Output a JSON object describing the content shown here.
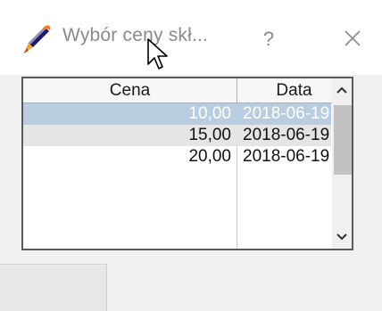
{
  "window": {
    "title": "Wybór ceny skł...",
    "help_glyph": "?",
    "close_glyph": "×"
  },
  "icons": {
    "app": "pencil-flame-icon",
    "help": "question-icon",
    "close": "close-icon",
    "cursor": "mouse-cursor-icon",
    "scroll_up": "chevron-up-icon",
    "scroll_down": "chevron-down-icon"
  },
  "grid": {
    "columns": [
      "Cena",
      "Data"
    ],
    "rows": [
      {
        "cena": "10,00",
        "data": "2018-06-19",
        "selected": true
      },
      {
        "cena": "15,00",
        "data": "2018-06-19",
        "selected": false
      },
      {
        "cena": "20,00",
        "data": "2018-06-19",
        "selected": false
      }
    ],
    "scroll_up_glyph": "^",
    "scroll_down_glyph": "v"
  },
  "colors": {
    "selected_row_bg": "#b9cde0",
    "alt_row_bg": "#e5e5e5",
    "title_text": "#8a8a8a"
  }
}
